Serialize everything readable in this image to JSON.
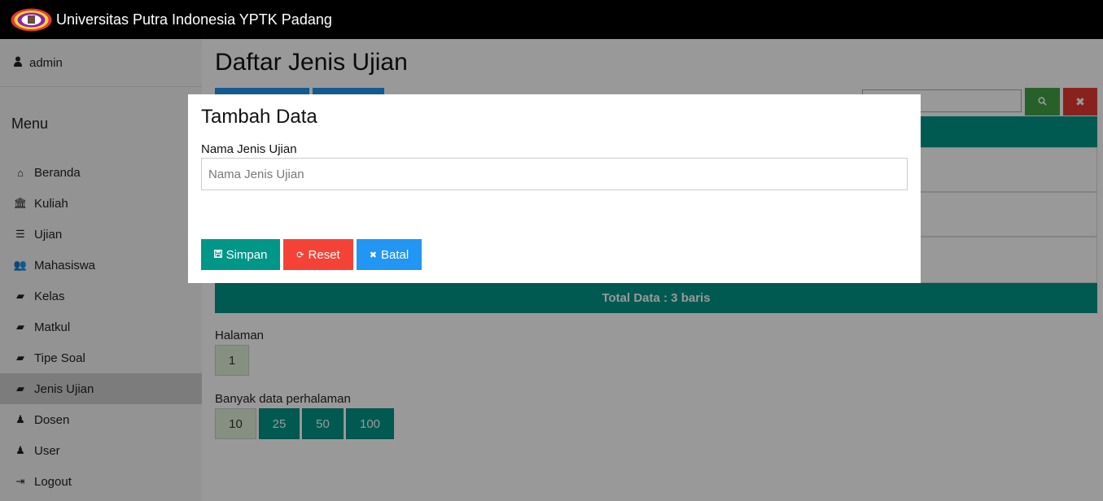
{
  "header": {
    "brand": "Universitas Putra Indonesia YPTK Padang"
  },
  "sidebar": {
    "user": "admin",
    "menu_title": "Menu",
    "items": [
      {
        "label": "Beranda",
        "icon": "home-icon"
      },
      {
        "label": "Kuliah",
        "icon": "institution-icon"
      },
      {
        "label": "Ujian",
        "icon": "list-icon"
      },
      {
        "label": "Mahasiswa",
        "icon": "users-icon"
      },
      {
        "label": "Kelas",
        "icon": "book-icon"
      },
      {
        "label": "Matkul",
        "icon": "book-icon"
      },
      {
        "label": "Tipe Soal",
        "icon": "book-icon"
      },
      {
        "label": "Jenis Ujian",
        "icon": "book-icon",
        "active": true
      },
      {
        "label": "Dosen",
        "icon": "user-md-icon"
      },
      {
        "label": "User",
        "icon": "user-md-icon"
      },
      {
        "label": "Logout",
        "icon": "sign-out-icon"
      }
    ]
  },
  "main": {
    "title": "Daftar Jenis Ujian",
    "total": "Total Data : 3 baris",
    "pagination_label": "Halaman",
    "pages": [
      "1"
    ],
    "per_page_label": "Banyak data perhalaman",
    "per_page_options": [
      "10",
      "25",
      "50",
      "100"
    ],
    "per_page_selected": "10"
  },
  "modal": {
    "title": "Tambah Data",
    "field_label": "Nama Jenis Ujian",
    "field_placeholder": "Nama Jenis Ujian",
    "field_value": "",
    "save_label": "Simpan",
    "reset_label": "Reset",
    "cancel_label": "Batal"
  },
  "colors": {
    "primary": "#009688",
    "blue": "#2196f3",
    "red": "#f44336",
    "green": "#43a047"
  }
}
